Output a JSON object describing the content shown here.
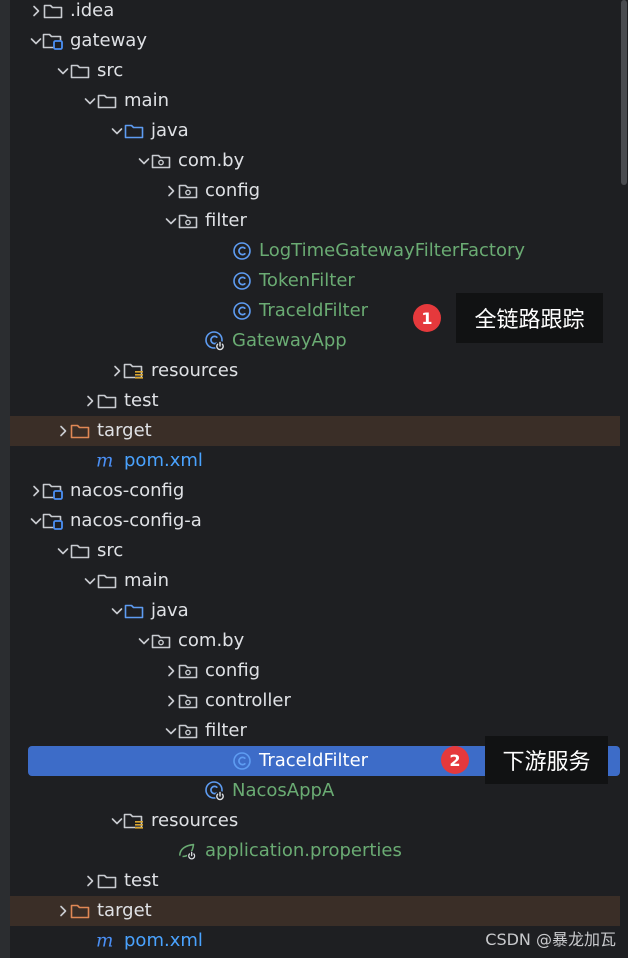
{
  "tree": {
    "rows": [
      {
        "label": "idea",
        "prefix": ".",
        "icon": "folder-icon",
        "depth": 1,
        "chevron": "right",
        "color": "default"
      },
      {
        "label": "gateway",
        "icon": "module-folder-icon",
        "depth": 1,
        "chevron": "down",
        "color": "default"
      },
      {
        "label": "src",
        "icon": "folder-icon",
        "depth": 2,
        "chevron": "down",
        "color": "default"
      },
      {
        "label": "main",
        "icon": "folder-icon",
        "depth": 3,
        "chevron": "down",
        "color": "default"
      },
      {
        "label": "java",
        "icon": "source-folder-icon",
        "depth": 4,
        "chevron": "down",
        "color": "default"
      },
      {
        "label": "com.by",
        "icon": "package-icon",
        "depth": 5,
        "chevron": "down",
        "color": "default"
      },
      {
        "label": "config",
        "icon": "package-icon",
        "depth": 6,
        "chevron": "right",
        "color": "default"
      },
      {
        "label": "filter",
        "icon": "package-icon",
        "depth": 6,
        "chevron": "down",
        "color": "default"
      },
      {
        "label": "LogTimeGatewayFilterFactory",
        "icon": "class-icon",
        "depth": 8,
        "chevron": "none",
        "color": "green"
      },
      {
        "label": "TokenFilter",
        "icon": "class-icon",
        "depth": 8,
        "chevron": "none",
        "color": "green"
      },
      {
        "label": "TraceIdFilter",
        "icon": "class-icon",
        "depth": 8,
        "chevron": "none",
        "color": "green"
      },
      {
        "label": "GatewayApp",
        "icon": "spring-boot-class-icon",
        "depth": 7,
        "chevron": "none",
        "color": "green"
      },
      {
        "label": "resources",
        "icon": "resources-folder-icon",
        "depth": 4,
        "chevron": "right",
        "color": "default"
      },
      {
        "label": "test",
        "icon": "folder-icon",
        "depth": 3,
        "chevron": "right",
        "color": "default"
      },
      {
        "label": "target",
        "icon": "excluded-folder-icon",
        "depth": 2,
        "chevron": "right",
        "color": "default",
        "excluded": true
      },
      {
        "label": "pom.xml",
        "icon": "maven-icon",
        "depth": 3,
        "chevron": "none",
        "color": "blue"
      },
      {
        "label": "nacos-config",
        "icon": "module-folder-icon",
        "depth": 1,
        "chevron": "right",
        "color": "default"
      },
      {
        "label": "nacos-config-a",
        "icon": "module-folder-icon",
        "depth": 1,
        "chevron": "down",
        "color": "default"
      },
      {
        "label": "src",
        "icon": "folder-icon",
        "depth": 2,
        "chevron": "down",
        "color": "default"
      },
      {
        "label": "main",
        "icon": "folder-icon",
        "depth": 3,
        "chevron": "down",
        "color": "default"
      },
      {
        "label": "java",
        "icon": "source-folder-icon",
        "depth": 4,
        "chevron": "down",
        "color": "default"
      },
      {
        "label": "com.by",
        "icon": "package-icon",
        "depth": 5,
        "chevron": "down",
        "color": "default"
      },
      {
        "label": "config",
        "icon": "package-icon",
        "depth": 6,
        "chevron": "right",
        "color": "default"
      },
      {
        "label": "controller",
        "icon": "package-icon",
        "depth": 6,
        "chevron": "right",
        "color": "default"
      },
      {
        "label": "filter",
        "icon": "package-icon",
        "depth": 6,
        "chevron": "down",
        "color": "default"
      },
      {
        "label": "TraceIdFilter",
        "icon": "class-icon",
        "depth": 8,
        "chevron": "none",
        "color": "green",
        "selected": true
      },
      {
        "label": "NacosAppA",
        "icon": "spring-boot-class-icon",
        "depth": 7,
        "chevron": "none",
        "color": "green"
      },
      {
        "label": "resources",
        "icon": "resources-folder-icon",
        "depth": 4,
        "chevron": "down",
        "color": "default"
      },
      {
        "label": "application.properties",
        "icon": "spring-properties-icon",
        "depth": 6,
        "chevron": "none",
        "color": "green"
      },
      {
        "label": "test",
        "icon": "folder-icon",
        "depth": 3,
        "chevron": "right",
        "color": "default"
      },
      {
        "label": "target",
        "icon": "excluded-folder-icon",
        "depth": 2,
        "chevron": "right",
        "color": "default",
        "excluded": true
      },
      {
        "label": "pom.xml",
        "icon": "maven-icon",
        "depth": 3,
        "chevron": "none",
        "color": "blue"
      }
    ]
  },
  "annotations": [
    {
      "number": "1",
      "text": "全链路跟踪"
    },
    {
      "number": "2",
      "text": "下游服务"
    }
  ],
  "watermark": "CSDN @暴龙加瓦",
  "colors": {
    "background": "#1e1f22",
    "text": "#dfe1e5",
    "class_text": "#6aab73",
    "maven_text": "#4aa3ff",
    "selection": "#3d6cc8",
    "excluded_row": "#3a2e27",
    "badge": "#e5393c"
  }
}
